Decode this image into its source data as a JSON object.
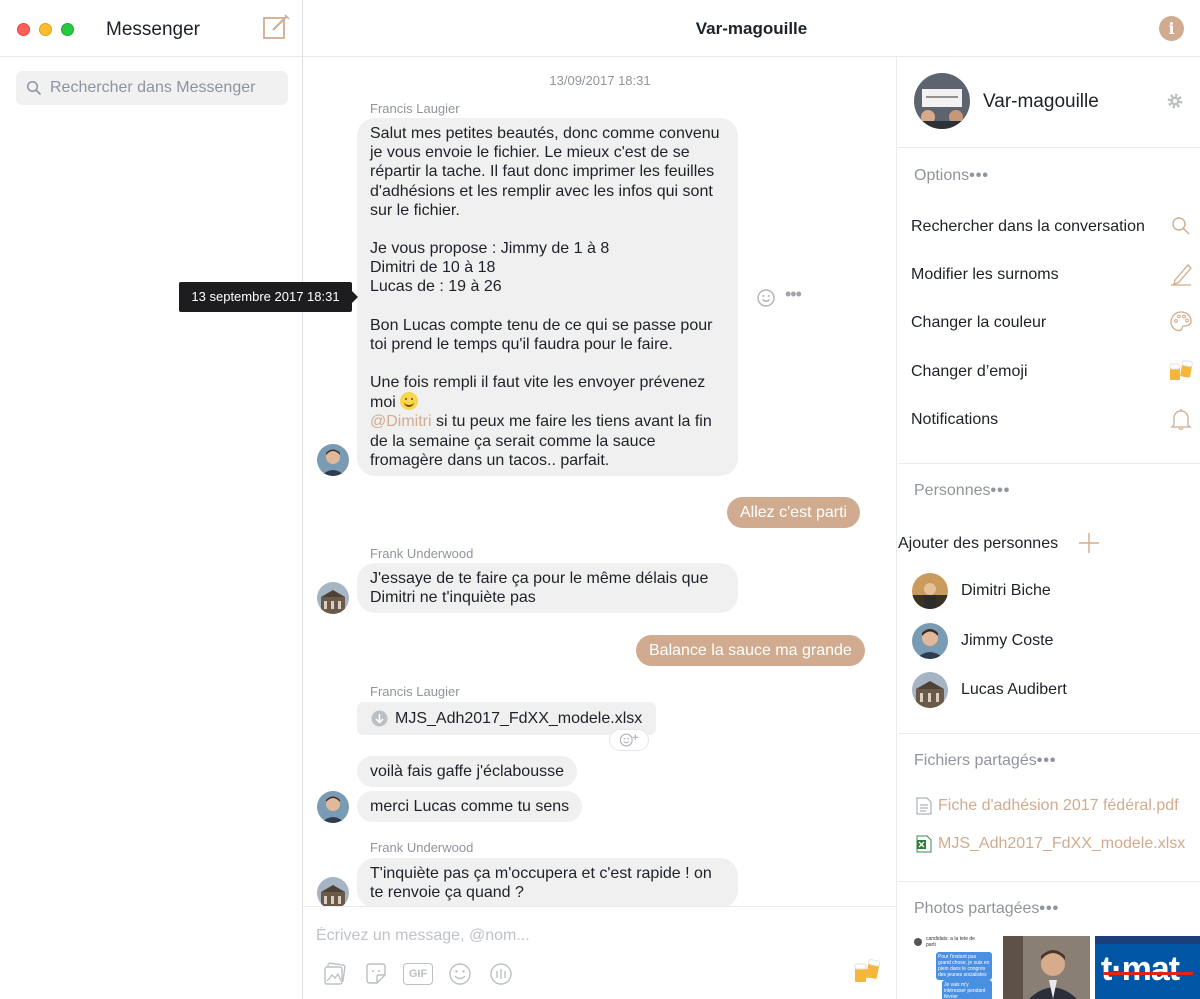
{
  "app": {
    "title": "Messenger"
  },
  "search": {
    "placeholder": "Rechercher dans Messenger"
  },
  "conversation": {
    "title": "Var-magouille",
    "timestamp": "13/09/2017 18:31",
    "tooltip": "13 septembre 2017 18:31",
    "messages": {
      "m1_sender": "Francis Laugier",
      "m1_p1": "Salut mes petites beautés, donc comme convenu je vous envoie le fichier. Le mieux c'est de se répartir la tache. Il faut donc imprimer les feuilles d'adhésions et les remplir avec les infos qui sont sur le fichier.",
      "m1_p2a": "Je vous propose : Jimmy de 1 à 8",
      "m1_p2b": "Dimitri de 10 à 18",
      "m1_p2c": "Lucas de : 19 à 26",
      "m1_p3": "Bon Lucas compte tenu de ce qui se passe pour toi prend le temps qu'il faudra pour le faire.",
      "m1_p4": "Une fois rempli il faut vite les envoyer prévenez moi",
      "m1_mention": "@Dimitri",
      "m1_p5": "si tu peux me faire les tiens avant la fin de la semaine ça serait comme la sauce fromagère dans un tacos.. parfait.",
      "out1": "Allez c'est parti",
      "m2_sender": "Frank Underwood",
      "m2_text": "J'essaye de te faire ça pour le même délais que Dimitri ne t'inquiète pas",
      "out2": "Balance la sauce ma grande",
      "m3_sender": "Francis Laugier",
      "m3_file": "MJS_Adh2017_FdXX_modele.xlsx",
      "m3_text1": "voilà fais gaffe j'éclabousse",
      "m3_text2": "merci Lucas comme tu sens",
      "m4_sender": "Frank Underwood",
      "m4_text": "T'inquiète pas ça m'occupera et c'est rapide ! on te renvoie ça quand ?"
    }
  },
  "composer": {
    "placeholder": "Écrivez un message, @nom...",
    "tools": [
      "image-icon",
      "sticker-icon",
      "gif-icon",
      "emoji-icon",
      "audio-icon"
    ],
    "gif_label": "GIF"
  },
  "details": {
    "group_name": "Var-magouille",
    "options_title": "Options",
    "options": [
      {
        "label": "Rechercher dans la conversation",
        "icon": "search-icon"
      },
      {
        "label": "Modifier les surnoms",
        "icon": "pencil-icon"
      },
      {
        "label": "Changer la couleur",
        "icon": "palette-icon"
      },
      {
        "label": "Changer d’emoji",
        "icon": "beer-emoji-icon"
      },
      {
        "label": "Notifications",
        "icon": "bell-icon"
      }
    ],
    "people_title": "Personnes",
    "add_people": "Ajouter des personnes",
    "people": [
      "Dimitri Biche",
      "Jimmy Coste",
      "Lucas Audibert"
    ],
    "files_title": "Fichiers partagés",
    "files": [
      "Fiche d'adhésion 2017 fédéral.pdf",
      "MJS_Adh2017_FdXX_modele.xlsx"
    ],
    "photos_title": "Photos partagées",
    "dots": "•••",
    "thumb_texts": [
      "candidats: a la tete de parti",
      "Pour l'instant pas grand chose, je suis en plein dans le congrès des jeunes socialistes",
      "Je vais m'y intéresser pendant février",
      "t·mat"
    ]
  },
  "colors": {
    "accent": "#d1ab8f",
    "bubble_in": "#f1f0f0"
  }
}
